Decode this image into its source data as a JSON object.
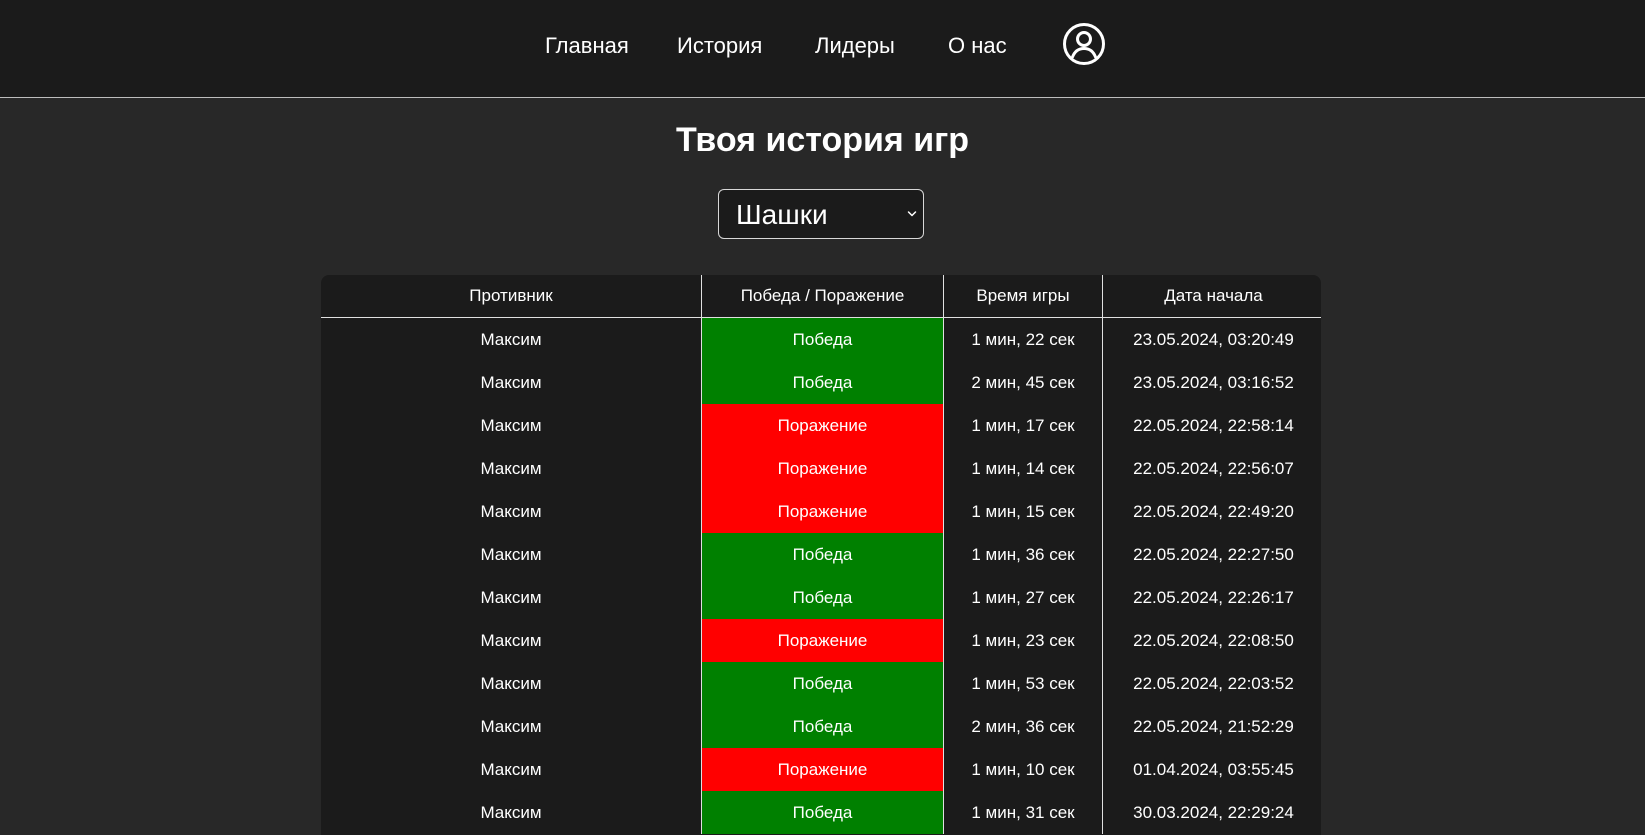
{
  "nav": {
    "home": "Главная",
    "history": "История",
    "leaders": "Лидеры",
    "about": "О нас",
    "profile_icon": "user-circle-icon"
  },
  "page": {
    "title": "Твоя история игр"
  },
  "game_select": {
    "selected": "Шашки"
  },
  "colors": {
    "win": "#008000",
    "loss": "#ff0000",
    "background": "#282828",
    "header": "#1b1b1b"
  },
  "table": {
    "headers": [
      "Противник",
      "Победа / Поражение",
      "Время игры",
      "Дата начала"
    ],
    "rows": [
      {
        "opponent": "Максим",
        "result": "Победа",
        "duration": "1 мин, 22 сек",
        "started": "23.05.2024, 03:20:49"
      },
      {
        "opponent": "Максим",
        "result": "Победа",
        "duration": "2 мин, 45 сек",
        "started": "23.05.2024, 03:16:52"
      },
      {
        "opponent": "Максим",
        "result": "Поражение",
        "duration": "1 мин, 17 сек",
        "started": "22.05.2024, 22:58:14"
      },
      {
        "opponent": "Максим",
        "result": "Поражение",
        "duration": "1 мин, 14 сек",
        "started": "22.05.2024, 22:56:07"
      },
      {
        "opponent": "Максим",
        "result": "Поражение",
        "duration": "1 мин, 15 сек",
        "started": "22.05.2024, 22:49:20"
      },
      {
        "opponent": "Максим",
        "result": "Победа",
        "duration": "1 мин, 36 сек",
        "started": "22.05.2024, 22:27:50"
      },
      {
        "opponent": "Максим",
        "result": "Победа",
        "duration": "1 мин, 27 сек",
        "started": "22.05.2024, 22:26:17"
      },
      {
        "opponent": "Максим",
        "result": "Поражение",
        "duration": "1 мин, 23 сек",
        "started": "22.05.2024, 22:08:50"
      },
      {
        "opponent": "Максим",
        "result": "Победа",
        "duration": "1 мин, 53 сек",
        "started": "22.05.2024, 22:03:52"
      },
      {
        "opponent": "Максим",
        "result": "Победа",
        "duration": "2 мин, 36 сек",
        "started": "22.05.2024, 21:52:29"
      },
      {
        "opponent": "Максим",
        "result": "Поражение",
        "duration": "1 мин, 10 сек",
        "started": "01.04.2024, 03:55:45"
      },
      {
        "opponent": "Максим",
        "result": "Победа",
        "duration": "1 мин, 31 сек",
        "started": "30.03.2024, 22:29:24"
      }
    ]
  }
}
